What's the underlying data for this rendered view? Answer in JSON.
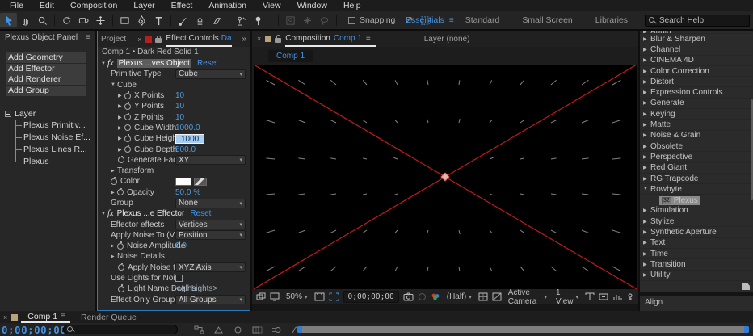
{
  "colors": {
    "accent_blue": "#3f93e8",
    "value_blue": "#4d9be0",
    "viewer_red": "#c21a1a",
    "dash_gray": "#9a9a9a",
    "anchor_pink": "#e8b2ae"
  },
  "menu": {
    "items": [
      {
        "label": "File"
      },
      {
        "label": "Edit"
      },
      {
        "label": "Composition"
      },
      {
        "label": "Layer"
      },
      {
        "label": "Effect"
      },
      {
        "label": "Animation"
      },
      {
        "label": "View"
      },
      {
        "label": "Window"
      },
      {
        "label": "Help"
      }
    ]
  },
  "toolbar": {
    "snapping": "Snapping",
    "workspaces": [
      {
        "label": "Essentials",
        "active": true
      },
      {
        "label": "Standard"
      },
      {
        "label": "Small Screen"
      },
      {
        "label": "Libraries"
      }
    ],
    "search_placeholder": "Search Help"
  },
  "plexus_panel": {
    "title": "Plexus Object Panel",
    "buttons": [
      {
        "label": "Add Geometry"
      },
      {
        "label": "Add Effector"
      },
      {
        "label": "Add Renderer"
      },
      {
        "label": "Add Group"
      }
    ],
    "tree_root": "Layer",
    "tree_items": [
      {
        "label": "Plexus Primitiv..."
      },
      {
        "label": "Plexus Noise Ef..."
      },
      {
        "label": "Plexus Lines R..."
      },
      {
        "label": "Plexus"
      }
    ]
  },
  "effect_controls": {
    "tab_project": "Project",
    "tab_title": "Effect Controls",
    "tab_suffix": "Da",
    "breadcrumb": "Comp 1 • Dark Red Solid 1",
    "rows": [
      {
        "indent": 0,
        "arrow": "▼",
        "fx": "fx",
        "label": "Plexus ...ves Object",
        "reset": "Reset",
        "selected": true
      },
      {
        "indent": 1,
        "label": "Primitive Type",
        "value": "Cube",
        "vstyle": "dropdown"
      },
      {
        "indent": 1,
        "arrow": "▼",
        "label": "Cube"
      },
      {
        "indent": 2,
        "arrow": "▶",
        "sw": true,
        "label": "X Points",
        "value": "10",
        "vstyle": "blue"
      },
      {
        "indent": 2,
        "arrow": "▶",
        "sw": true,
        "label": "Y Points",
        "value": "10",
        "vstyle": "blue"
      },
      {
        "indent": 2,
        "arrow": "▶",
        "sw": true,
        "label": "Z Points",
        "value": "10",
        "vstyle": "blue"
      },
      {
        "indent": 2,
        "arrow": "▶",
        "sw": true,
        "label": "Cube Width",
        "value": "1000.0",
        "vstyle": "blue"
      },
      {
        "indent": 2,
        "arrow": "▶",
        "sw": true,
        "label": "Cube Height",
        "value": "1000",
        "vstyle": "input"
      },
      {
        "indent": 2,
        "arrow": "▶",
        "sw": true,
        "label": "Cube Depth",
        "value": "500.0",
        "vstyle": "blue"
      },
      {
        "indent": 2,
        "sw": true,
        "label": "Generate Faces",
        "value": "XY",
        "vstyle": "dropdown"
      },
      {
        "indent": 1,
        "arrow": "▶",
        "label": "Transform"
      },
      {
        "indent": 1,
        "sw": true,
        "label": "Color",
        "vstyle": "color"
      },
      {
        "indent": 1,
        "arrow": "▶",
        "sw": true,
        "label": "Opacity",
        "value": "50.0 %",
        "vstyle": "blue"
      },
      {
        "indent": 1,
        "label": "Group",
        "value": "None",
        "vstyle": "dropdown"
      },
      {
        "indent": 0,
        "arrow": "▼",
        "fx": "fx",
        "label": "Plexus ...e Effector",
        "reset": "Reset"
      },
      {
        "indent": 1,
        "label": "Effector effects",
        "value": "Vertices",
        "vstyle": "dropdown"
      },
      {
        "indent": 1,
        "label": "Apply Noise To (Verti",
        "value": "Position",
        "vstyle": "dropdown"
      },
      {
        "indent": 1,
        "arrow": "▶",
        "sw": true,
        "label": "Noise Amplitude",
        "value": "0.0",
        "vstyle": "blue"
      },
      {
        "indent": 1,
        "arrow": "▶",
        "label": "Noise Details"
      },
      {
        "indent": 2,
        "sw": true,
        "label": "Apply Noise to Axi",
        "value": "XYZ Axis",
        "vstyle": "dropdown"
      },
      {
        "indent": 1,
        "label": "Use Lights for Noise",
        "vstyle": "checkbox"
      },
      {
        "indent": 2,
        "sw": true,
        "label": "Light Name Begins",
        "value": "<All Lights>",
        "vstyle": "link"
      },
      {
        "indent": 1,
        "label": "Effect Only Group",
        "value": "All Groups",
        "vstyle": "dropdown"
      }
    ]
  },
  "composition": {
    "tab_label": "Composition",
    "comp_name": "Comp 1",
    "layer_tab": "Layer (none)",
    "subtab": "Comp 1",
    "zoom": "50%",
    "timecode": "0;00;00;00",
    "resolution": "(Half)",
    "camera": "Active Camera",
    "view": "1 View"
  },
  "viewer": {
    "background": "#000000",
    "line_color": "#c21a1a",
    "dash_color": "#9a9a9a",
    "anchor_color": "#e8b2ae"
  },
  "effects_panel": {
    "items": [
      {
        "clip": true,
        "arrow": "▶",
        "label": "Audio"
      },
      {
        "arrow": "▶",
        "label": "Blur & Sharpen"
      },
      {
        "arrow": "▶",
        "label": "Channel"
      },
      {
        "arrow": "▶",
        "label": "CINEMA 4D"
      },
      {
        "arrow": "▶",
        "label": "Color Correction"
      },
      {
        "arrow": "▶",
        "label": "Distort"
      },
      {
        "arrow": "▶",
        "label": "Expression Controls"
      },
      {
        "arrow": "▶",
        "label": "Generate"
      },
      {
        "arrow": "▶",
        "label": "Keying"
      },
      {
        "arrow": "▶",
        "label": "Matte"
      },
      {
        "arrow": "▶",
        "label": "Noise & Grain"
      },
      {
        "arrow": "▶",
        "label": "Obsolete"
      },
      {
        "arrow": "▶",
        "label": "Perspective"
      },
      {
        "arrow": "▶",
        "label": "Red Giant"
      },
      {
        "arrow": "▶",
        "label": "RG Trapcode"
      },
      {
        "arrow": "▼",
        "label": "Rowbyte"
      },
      {
        "indent": 1,
        "label": "Plexus",
        "badge": "32",
        "selected": true
      },
      {
        "arrow": "▶",
        "label": "Simulation"
      },
      {
        "arrow": "▶",
        "label": "Stylize"
      },
      {
        "arrow": "▶",
        "label": "Synthetic Aperture"
      },
      {
        "arrow": "▶",
        "label": "Text"
      },
      {
        "arrow": "▶",
        "label": "Time"
      },
      {
        "arrow": "▶",
        "label": "Transition"
      },
      {
        "arrow": "▶",
        "label": "Utility"
      }
    ],
    "align_title": "Align"
  },
  "timeline": {
    "tab": "Comp 1",
    "render_queue": "Render Queue",
    "timecode": "0;00;00;00"
  }
}
